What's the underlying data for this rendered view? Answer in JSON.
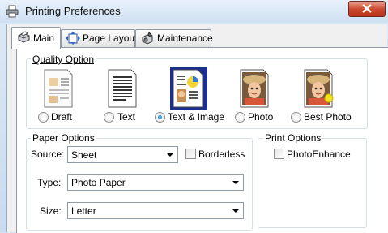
{
  "window": {
    "title": "Printing Preferences",
    "close_icon": "close-icon",
    "accent": "#c9462c"
  },
  "tabs": [
    {
      "label": "Main",
      "icon": "printer-icon",
      "active": true
    },
    {
      "label": "Page Layout",
      "icon": "page-layout-icon",
      "active": false
    },
    {
      "label": "Maintenance",
      "icon": "maintenance-icon",
      "active": false
    }
  ],
  "quality": {
    "label": "Quality Option",
    "options": [
      {
        "label": "Draft",
        "underline": "f",
        "icon": "draft-icon",
        "selected": false
      },
      {
        "label": "Text",
        "underline": "x",
        "icon": "text-icon",
        "selected": false
      },
      {
        "label": "Text & Image",
        "underline": "I",
        "icon": "text-image-icon",
        "selected": true
      },
      {
        "label": "Photo",
        "underline": "o",
        "icon": "photo-icon",
        "selected": false
      },
      {
        "label": "Best Photo",
        "underline": "B",
        "icon": "best-photo-icon",
        "selected": false
      }
    ]
  },
  "paper": {
    "label": "Paper Options",
    "source_label": "Source:",
    "source_value": "Sheet",
    "borderless_label": "Borderless",
    "borderless_checked": false,
    "type_label": "Type:",
    "type_value": "Photo Paper",
    "size_label": "Size:",
    "size_value": "Letter"
  },
  "print": {
    "label": "Print Options",
    "photoenhance_label": "PhotoEnhance",
    "photoenhance_checked": false
  }
}
